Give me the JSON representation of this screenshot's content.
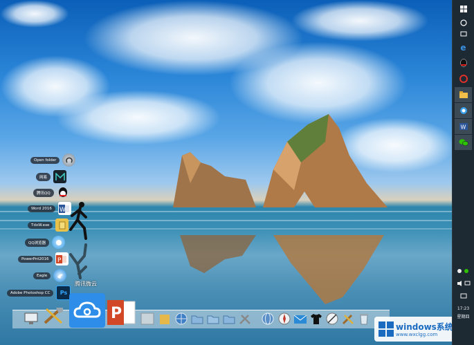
{
  "desktop": {
    "wallpaper": "beach-rocks-sunrise"
  },
  "launcher": {
    "items": [
      {
        "label": "Open folder",
        "icon": "open-folder-icon",
        "color": "#7a8a99"
      },
      {
        "label": "网易",
        "icon": "m-app-icon",
        "color": "#17222b"
      },
      {
        "label": "腾讯QQ",
        "icon": "qq-icon",
        "color": "#111111"
      },
      {
        "label": "Word 2016",
        "icon": "word-icon",
        "color": "#2b579a"
      },
      {
        "label": "TdxW.exe",
        "icon": "tdx-icon",
        "color": "#e8c24a"
      },
      {
        "label": "QQ浏览器",
        "icon": "qq-browser-icon",
        "color": "#3aa0e8"
      },
      {
        "label": "PowerPnt2016",
        "icon": "powerpoint-icon",
        "color": "#d24726"
      },
      {
        "label": "Eagle",
        "icon": "eagle-icon",
        "color": "#1b88e0"
      },
      {
        "label": "Adobe Photoshop CC",
        "icon": "photoshop-icon",
        "color": "#0b2b4a"
      }
    ]
  },
  "dock": {
    "caption": "腾讯微云",
    "items": [
      "system-monitor-icon",
      "tools-icon",
      "weiyun-icon",
      "powerpoint-icon",
      "blank-icon",
      "folder-icon",
      "globe-icon",
      "folder-icon",
      "folder-icon",
      "folder-icon",
      "utilities-icon",
      "network-globe-icon",
      "compass-icon",
      "mail-icon",
      "tshirt-icon",
      "compass-icon",
      "tools-icon",
      "recycle-bin-icon"
    ]
  },
  "taskbar": {
    "clock": "17:23",
    "date": "星期四",
    "buttons": [
      "windows-start-icon",
      "cortana-icon",
      "task-view-icon",
      "edge-icon",
      "qq-icon",
      "wps-icon",
      "file-explorer-icon",
      "qq-browser-icon",
      "word-icon",
      "wechat-icon"
    ]
  },
  "watermark": {
    "title": "windows系统城",
    "url": "www.wxclgg.com"
  }
}
